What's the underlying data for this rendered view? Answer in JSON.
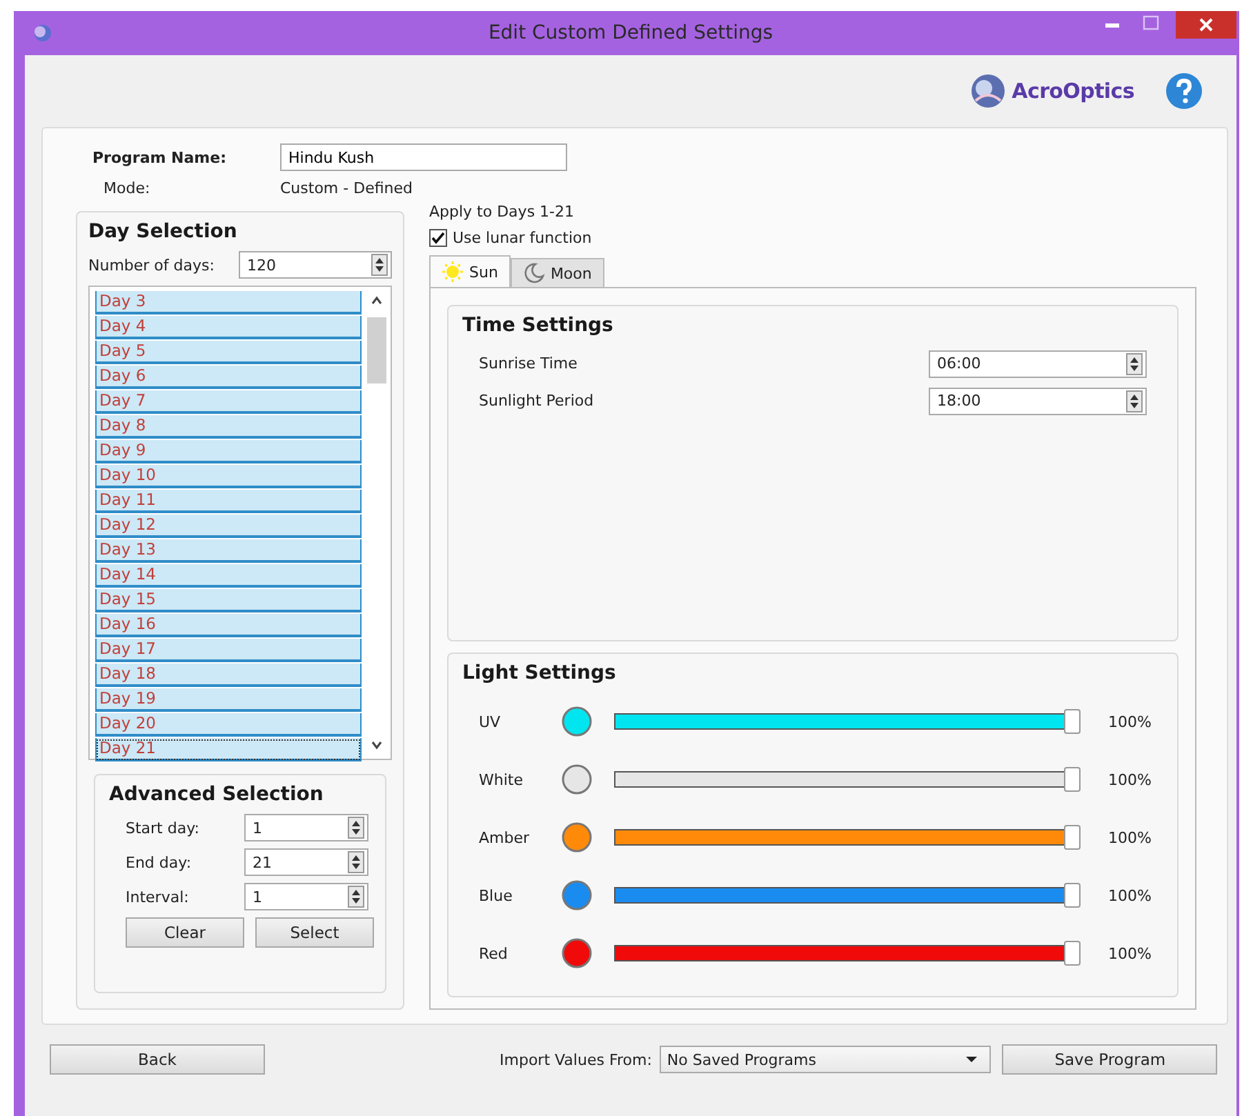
{
  "window": {
    "title": "Edit Custom Defined Settings"
  },
  "brand": {
    "name": "AcroOptics"
  },
  "program": {
    "name_label": "Program Name:",
    "name_value": "Hindu Kush",
    "mode_label": "Mode:",
    "mode_value": "Custom - Defined"
  },
  "day_selection": {
    "title": "Day Selection",
    "count_label": "Number of days:",
    "count_value": "120",
    "days": [
      {
        "label": "Day 3",
        "selected": true
      },
      {
        "label": "Day 4",
        "selected": true
      },
      {
        "label": "Day 5",
        "selected": true
      },
      {
        "label": "Day 6",
        "selected": true
      },
      {
        "label": "Day 7",
        "selected": true
      },
      {
        "label": "Day 8",
        "selected": true
      },
      {
        "label": "Day 9",
        "selected": true
      },
      {
        "label": "Day 10",
        "selected": true
      },
      {
        "label": "Day 11",
        "selected": true
      },
      {
        "label": "Day 12",
        "selected": true
      },
      {
        "label": "Day 13",
        "selected": true
      },
      {
        "label": "Day 14",
        "selected": true
      },
      {
        "label": "Day 15",
        "selected": true
      },
      {
        "label": "Day 16",
        "selected": true
      },
      {
        "label": "Day 17",
        "selected": true
      },
      {
        "label": "Day 18",
        "selected": true
      },
      {
        "label": "Day 19",
        "selected": true
      },
      {
        "label": "Day 20",
        "selected": true
      },
      {
        "label": "Day 21",
        "selected": true
      }
    ]
  },
  "advanced_selection": {
    "title": "Advanced Selection",
    "fields": [
      {
        "label": "Start day:",
        "value": "1"
      },
      {
        "label": "End day:",
        "value": "21"
      },
      {
        "label": "Interval:",
        "value": "1"
      }
    ],
    "buttons": [
      "Clear",
      "Select"
    ]
  },
  "apply_label": "Apply to Days 1-21",
  "lunar": {
    "label": "Use lunar function",
    "checked": true
  },
  "tabs": [
    {
      "label": "Sun",
      "kind": "sun",
      "selected": true
    },
    {
      "label": "Moon",
      "kind": "moon",
      "selected": false
    }
  ],
  "time_settings": {
    "title": "Time Settings",
    "fields": [
      {
        "label": "Sunrise Time",
        "value": "06:00"
      },
      {
        "label": "Sunlight Period",
        "value": "18:00"
      }
    ]
  },
  "light_settings": {
    "title": "Light Settings",
    "channels": [
      {
        "name": "UV",
        "color": "#00e5f0",
        "level": 1,
        "reading": "100%"
      },
      {
        "name": "White",
        "color": "#e6e6e6",
        "level": 1,
        "reading": "100%"
      },
      {
        "name": "Amber",
        "color": "#ff8a0a",
        "level": 1,
        "reading": "100%"
      },
      {
        "name": "Blue",
        "color": "#1a8cf0",
        "level": 1,
        "reading": "100%"
      },
      {
        "name": "Red",
        "color": "#f00a0a",
        "level": 1,
        "reading": "100%"
      }
    ]
  },
  "footer": {
    "back": "Back",
    "import_label": "Import Values From:",
    "import_value": "No Saved Programs",
    "save": "Save Program"
  }
}
